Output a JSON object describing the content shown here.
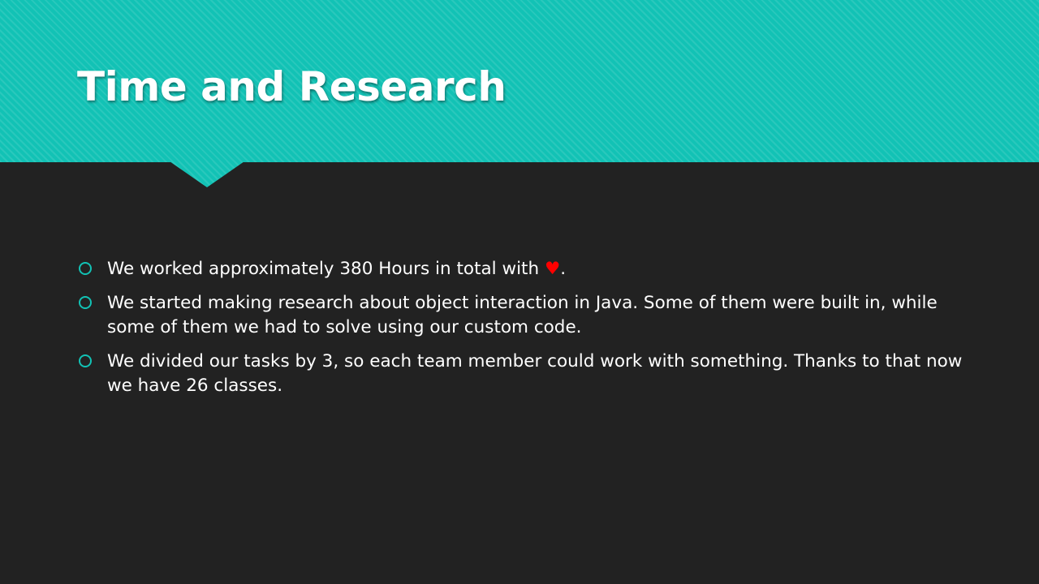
{
  "slide": {
    "title": "Time and Research",
    "bullets": [
      {
        "text_before": "We worked approximately 380 Hours in total with ",
        "heart": "♥",
        "text_after": "."
      },
      {
        "text": "We started making research about object interaction in Java. Some of them were built in, while some of them we had to solve using our custom code."
      },
      {
        "text": "We divided our tasks by 3, so each team member could work with something. Thanks to that now we have 26 classes."
      }
    ]
  },
  "colors": {
    "background": "#222222",
    "accent": "#12c2b5",
    "title_text": "#ffffff",
    "body_text": "#ffffff",
    "heart": "#ff0000"
  },
  "icons": {
    "bullet_marker": "hollow-circle-icon",
    "heart": "heart-icon"
  }
}
